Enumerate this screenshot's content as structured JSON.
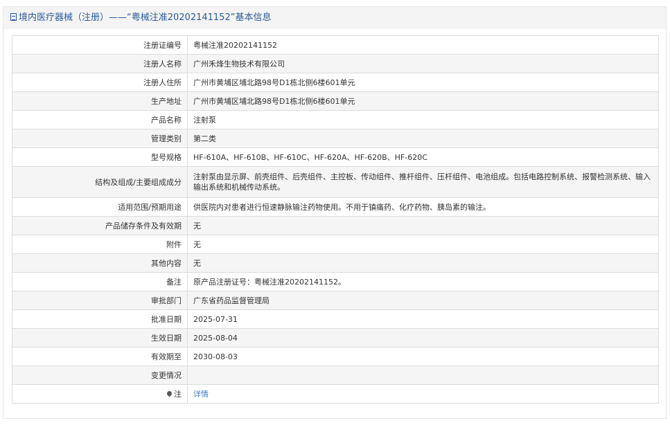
{
  "header": {
    "title": "境内医疗器械（注册）——“粤械注准20202141152”基本信息"
  },
  "rows": [
    {
      "label": "注册证编号",
      "value": "粤械注准20202141152"
    },
    {
      "label": "注册人名称",
      "value": "广州禾烽生物技术有限公司"
    },
    {
      "label": "注册人住所",
      "value": "广州市黄埔区埔北路98号D1栋北侧6楼601单元"
    },
    {
      "label": "生产地址",
      "value": "广州市黄埔区埔北路98号D1栋北侧6楼601单元"
    },
    {
      "label": "产品名称",
      "value": "注射泵"
    },
    {
      "label": "管理类别",
      "value": "第二类"
    },
    {
      "label": "型号规格",
      "value": "HF-610A、HF-610B、HF-610C、HF-620A、HF-620B、HF-620C"
    },
    {
      "label": "结构及组成/主要组成成分",
      "value": "注射泵由显示屏、前壳组件、后壳组件、主控板、传动组件、推杆组件、压杆组件、电池组成。包括电路控制系统、报警检测系统、输入输出系统和机械传动系统。"
    },
    {
      "label": "适用范围/预期用途",
      "value": "供医院内对患者进行恒速静脉输注药物使用。不用于镇痛药、化疗药物、胰岛素的输注。"
    },
    {
      "label": "产品储存条件及有效期",
      "value": "无"
    },
    {
      "label": "附件",
      "value": "无"
    },
    {
      "label": "其他内容",
      "value": "无"
    },
    {
      "label": "备注",
      "value": "原产品注册证号：粤械注准20202141152。"
    },
    {
      "label": "审批部门",
      "value": "广东省药品监督管理局"
    },
    {
      "label": "批准日期",
      "value": "2025-07-31"
    },
    {
      "label": "生效日期",
      "value": "2025-08-04"
    },
    {
      "label": "有效期至",
      "value": "2030-08-03"
    },
    {
      "label": "变更情况",
      "value": ""
    },
    {
      "label": "注",
      "value": "详情",
      "icon": "pin-icon"
    }
  ]
}
